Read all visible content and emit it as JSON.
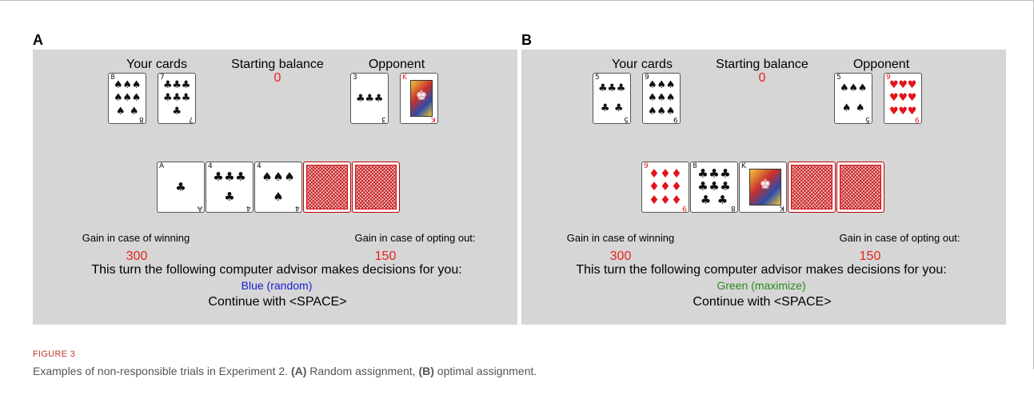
{
  "panels": [
    {
      "letter": "A",
      "your_cards_label": "Your cards",
      "starting_balance_label": "Starting balance",
      "starting_balance_value": "0",
      "opponent_label": "Opponent",
      "your_cards": [
        {
          "rank": "8",
          "suit": "spades",
          "pips": "♠♠♠♠♠♠♠♠"
        },
        {
          "rank": "7",
          "suit": "clubs",
          "pips": "♣♣♣♣♣♣♣"
        }
      ],
      "opponent_cards": [
        {
          "rank": "3",
          "suit": "clubs",
          "pips": "♣♣♣"
        },
        {
          "rank": "K",
          "suit": "hearts",
          "face": true
        }
      ],
      "table_cards": [
        {
          "rank": "A",
          "suit": "clubs",
          "pips": "♣"
        },
        {
          "rank": "4",
          "suit": "clubs",
          "pips": "♣♣♣♣"
        },
        {
          "rank": "4",
          "suit": "spades",
          "pips": "♠♠♠♠"
        }
      ],
      "hidden_cards": 2,
      "gain_winning_label": "Gain in case of winning",
      "gain_optout_label": "Gain in case of opting out:",
      "gain_winning_value": "300",
      "gain_optout_value": "150",
      "advisor_text": "This turn the following computer advisor makes decisions for you:",
      "advisor_name": "Blue (random)",
      "advisor_color": "#1a1ad6",
      "continue_text": "Continue with <SPACE>"
    },
    {
      "letter": "B",
      "your_cards_label": "Your cards",
      "starting_balance_label": "Starting balance",
      "starting_balance_value": "0",
      "opponent_label": "Opponent",
      "your_cards": [
        {
          "rank": "5",
          "suit": "clubs",
          "pips": "♣♣♣♣♣"
        },
        {
          "rank": "9",
          "suit": "spades",
          "pips": "♠♠♠♠♠♠♠♠♠"
        }
      ],
      "opponent_cards": [
        {
          "rank": "5",
          "suit": "spades",
          "pips": "♠♠♠♠♠"
        },
        {
          "rank": "9",
          "suit": "hearts",
          "pips": "♥♥♥♥♥♥♥♥♥"
        }
      ],
      "table_cards": [
        {
          "rank": "9",
          "suit": "diamonds",
          "pips": "♦♦♦♦♦♦♦♦♦"
        },
        {
          "rank": "8",
          "suit": "clubs",
          "pips": "♣♣♣♣♣♣♣♣"
        },
        {
          "rank": "K",
          "suit": "clubs",
          "face": true
        }
      ],
      "hidden_cards": 2,
      "gain_winning_label": "Gain in case of winning",
      "gain_optout_label": "Gain in case of opting out:",
      "gain_winning_value": "300",
      "gain_optout_value": "150",
      "advisor_text": "This turn the following computer advisor makes decisions for you:",
      "advisor_name": "Green (maximize)",
      "advisor_color": "#2a8a1c",
      "continue_text": "Continue with <SPACE>"
    }
  ],
  "caption": {
    "figure_label": "FIGURE 3",
    "text_prefix": "Examples of non-responsible trials in Experiment 2. ",
    "a_marker": "(A)",
    "a_text": " Random assignment, ",
    "b_marker": "(B)",
    "b_text": " optimal assignment."
  }
}
